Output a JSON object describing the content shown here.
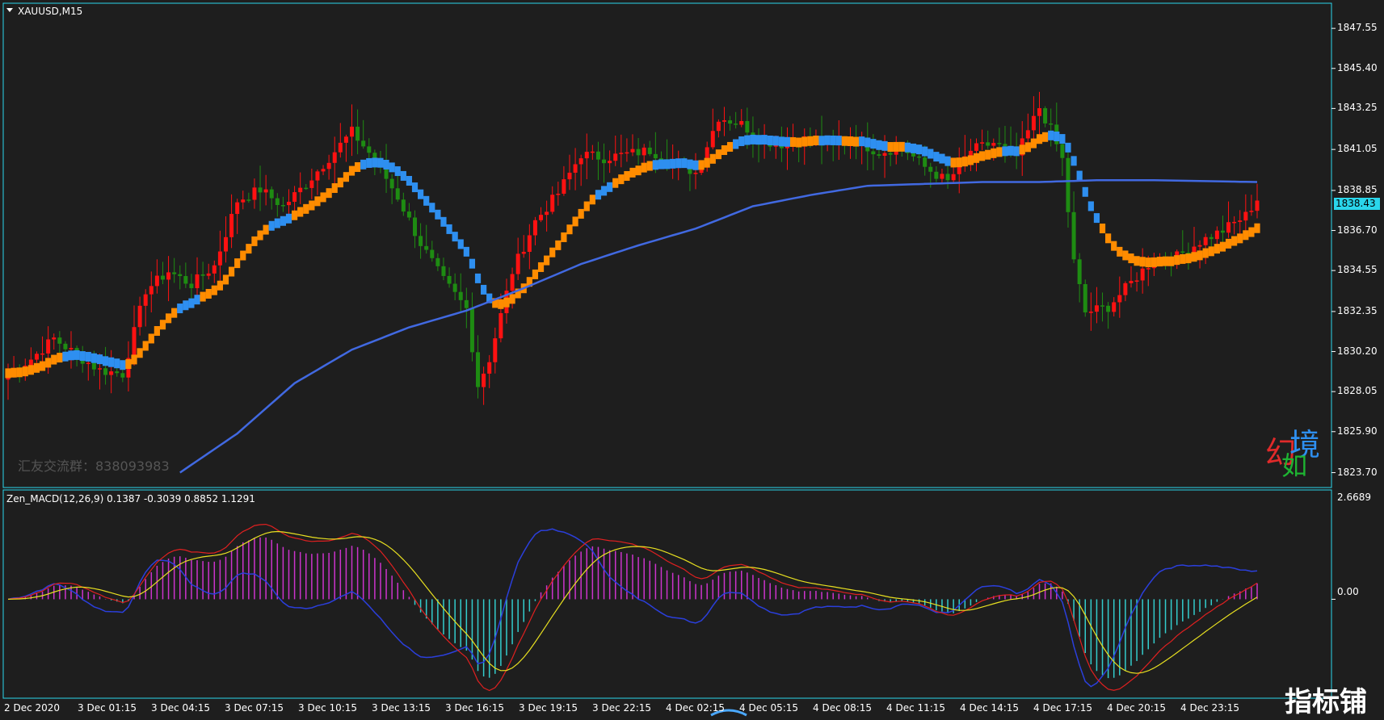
{
  "chart": {
    "symbol_label": "XAUUSD,M15",
    "current_price": "1838.43",
    "watermark": "汇友交流群：838093983",
    "brand_chars": [
      "幻",
      "境",
      "如"
    ],
    "price_axis": [
      "1847.55",
      "1845.40",
      "1843.25",
      "1841.05",
      "1838.85",
      "1836.70",
      "1834.55",
      "1832.35",
      "1830.20",
      "1828.05",
      "1825.90",
      "1823.70"
    ],
    "time_axis": [
      "2 Dec 2020",
      "3 Dec 01:15",
      "3 Dec 04:15",
      "3 Dec 07:15",
      "3 Dec 10:15",
      "3 Dec 13:15",
      "3 Dec 16:15",
      "3 Dec 19:15",
      "3 Dec 22:15",
      "4 Dec 02:15",
      "4 Dec 05:15",
      "4 Dec 08:15",
      "4 Dec 11:15",
      "4 Dec 14:15",
      "4 Dec 17:15",
      "4 Dec 20:15",
      "4 Dec 23:15"
    ],
    "colors": {
      "background": "#1e1e1e",
      "border": "#2ad6ec",
      "bull": "#ff1111",
      "bear": "#1e8c12",
      "trend_up": "#ff8c00",
      "trend_down": "#2e8ff0",
      "ma": "#4169e1",
      "macd_pos": "#cc33cc",
      "macd_neg": "#33cccc",
      "macd_line": "#e02020",
      "signal_line": "#e8e020"
    }
  },
  "indicator": {
    "label": "Zen_MACD(12,26,9) 0.1387 -0.3039 0.8852 1.1291",
    "axis": [
      "2.6689",
      "0.00"
    ]
  },
  "site_logo_text": "指标铺",
  "chart_data": {
    "type": "candlestick",
    "title": "XAUUSD,M15",
    "ylim": [
      1822.9,
      1848.9
    ],
    "y_ticks": [
      1847.55,
      1845.4,
      1843.25,
      1841.05,
      1838.85,
      1836.7,
      1834.55,
      1832.35,
      1830.2,
      1828.05,
      1825.9,
      1823.7
    ],
    "x_ticks": [
      "2 Dec 2020",
      "3 Dec 01:15",
      "3 Dec 04:15",
      "3 Dec 07:15",
      "3 Dec 10:15",
      "3 Dec 13:15",
      "3 Dec 16:15",
      "3 Dec 19:15",
      "3 Dec 22:15",
      "4 Dec 02:15",
      "4 Dec 05:15",
      "4 Dec 08:15",
      "4 Dec 11:15",
      "4 Dec 14:15",
      "4 Dec 17:15",
      "4 Dec 20:15",
      "4 Dec 23:15"
    ],
    "close_path": [
      [
        0,
        1829.0
      ],
      [
        4,
        1829.8
      ],
      [
        8,
        1830.9
      ],
      [
        12,
        1830.0
      ],
      [
        16,
        1829.2
      ],
      [
        20,
        1829.0
      ],
      [
        24,
        1833.5
      ],
      [
        28,
        1834.5
      ],
      [
        32,
        1833.8
      ],
      [
        36,
        1834.8
      ],
      [
        40,
        1838.3
      ],
      [
        44,
        1838.9
      ],
      [
        48,
        1838.0
      ],
      [
        52,
        1839.2
      ],
      [
        56,
        1840.6
      ],
      [
        60,
        1842.0
      ],
      [
        64,
        1840.5
      ],
      [
        68,
        1838.5
      ],
      [
        72,
        1836.0
      ],
      [
        76,
        1834.0
      ],
      [
        80,
        1832.5
      ],
      [
        82,
        1828.4
      ],
      [
        84,
        1829.8
      ],
      [
        88,
        1834.5
      ],
      [
        92,
        1837.2
      ],
      [
        96,
        1838.7
      ],
      [
        100,
        1840.8
      ],
      [
        104,
        1840.6
      ],
      [
        108,
        1840.8
      ],
      [
        112,
        1841.0
      ],
      [
        116,
        1840.4
      ],
      [
        120,
        1839.8
      ],
      [
        124,
        1842.8
      ],
      [
        128,
        1842.4
      ],
      [
        132,
        1841.5
      ],
      [
        136,
        1841.3
      ],
      [
        140,
        1841.7
      ],
      [
        144,
        1841.3
      ],
      [
        148,
        1841.5
      ],
      [
        152,
        1840.9
      ],
      [
        156,
        1841.2
      ],
      [
        160,
        1840.1
      ],
      [
        164,
        1839.3
      ],
      [
        168,
        1841.0
      ],
      [
        172,
        1841.4
      ],
      [
        176,
        1840.7
      ],
      [
        180,
        1843.3
      ],
      [
        182,
        1842.1
      ],
      [
        184,
        1840.5
      ],
      [
        186,
        1835.0
      ],
      [
        188,
        1832.3
      ],
      [
        192,
        1832.6
      ],
      [
        196,
        1833.9
      ],
      [
        200,
        1835.2
      ],
      [
        204,
        1835.3
      ],
      [
        208,
        1836.1
      ],
      [
        212,
        1836.7
      ],
      [
        216,
        1837.5
      ],
      [
        218,
        1838.4
      ]
    ],
    "ma_line": [
      [
        30,
        1823.7
      ],
      [
        40,
        1825.8
      ],
      [
        50,
        1828.5
      ],
      [
        60,
        1830.3
      ],
      [
        70,
        1831.5
      ],
      [
        80,
        1832.4
      ],
      [
        90,
        1833.6
      ],
      [
        100,
        1834.9
      ],
      [
        110,
        1835.9
      ],
      [
        120,
        1836.8
      ],
      [
        130,
        1838.0
      ],
      [
        140,
        1838.6
      ],
      [
        150,
        1839.1
      ],
      [
        160,
        1839.2
      ],
      [
        170,
        1839.3
      ],
      [
        180,
        1839.3
      ],
      [
        190,
        1839.4
      ],
      [
        200,
        1839.4
      ],
      [
        218,
        1839.3
      ]
    ],
    "series": [
      {
        "name": "Zen_MACD(12,26,9)",
        "values": [
          0.1387,
          -0.3039,
          0.8852,
          1.1291
        ]
      }
    ]
  }
}
